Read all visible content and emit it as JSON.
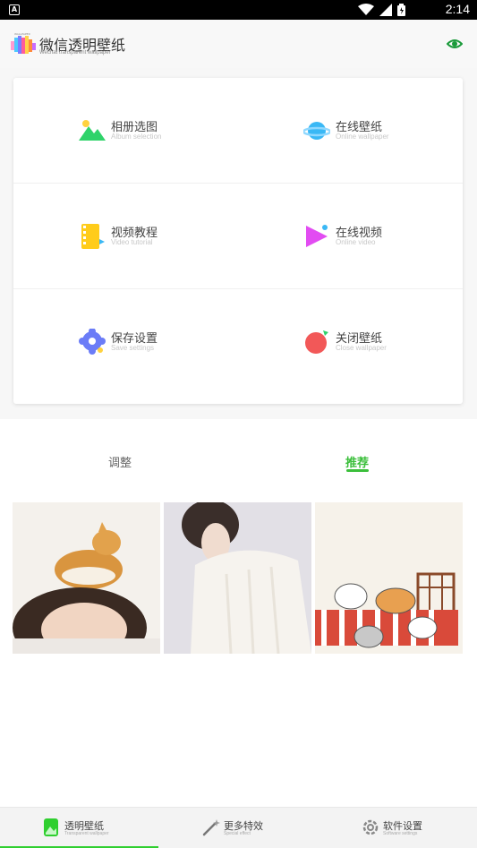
{
  "status_bar": {
    "notification_glyph": "A",
    "time": "2:14",
    "icons": [
      "wifi-icon",
      "signal-icon",
      "battery-icon"
    ]
  },
  "app_bar": {
    "logo_tag": "WALLPAPER",
    "title": "微信透明壁纸",
    "subtitle": "Wechat transparent wallpaper",
    "eye_icon": "eye-icon",
    "accent_color": "#1a9a3a"
  },
  "menu": {
    "items": [
      {
        "label": "相册选图",
        "sub": "Album selection",
        "icon": "mountain-icon"
      },
      {
        "label": "在线壁纸",
        "sub": "Online wallpaper",
        "icon": "planet-icon"
      },
      {
        "label": "视频教程",
        "sub": "Video tutorial",
        "icon": "film-icon"
      },
      {
        "label": "在线视频",
        "sub": "Online video",
        "icon": "play-icon"
      },
      {
        "label": "保存设置",
        "sub": "Save settings",
        "icon": "gear-icon"
      },
      {
        "label": "关闭壁纸",
        "sub": "Close wallpaper",
        "icon": "close-circle-icon"
      }
    ]
  },
  "tabs": {
    "adjust": "调整",
    "recommend": "推荐",
    "active": "recommend",
    "active_color": "#3bbf3b"
  },
  "thumbnails": [
    {
      "name": "shiba-girl-thumbnail"
    },
    {
      "name": "white-sweater-thumbnail"
    },
    {
      "name": "cats-sofa-thumbnail"
    }
  ],
  "bottom_nav": {
    "items": [
      {
        "label": "透明壁纸",
        "sub": "Transparent wallpaper",
        "icon": "wallpaper-icon"
      },
      {
        "label": "更多特效",
        "sub": "Special effect",
        "icon": "magic-wand-icon"
      },
      {
        "label": "软件设置",
        "sub": "Software settings",
        "icon": "settings-icon"
      }
    ],
    "active_index": 0,
    "active_color": "#2fcf2f"
  }
}
